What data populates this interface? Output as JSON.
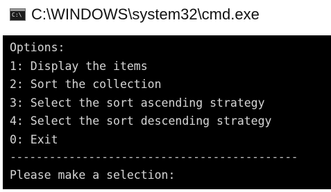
{
  "window": {
    "title": "C:\\WINDOWS\\system32\\cmd.exe",
    "icon": "cmd-console-icon",
    "icon_text": "C:\\"
  },
  "console": {
    "header": "Options:",
    "options": [
      "1: Display the items",
      "2: Sort the collection",
      "3: Select the sort ascending strategy",
      "4: Select the sort descending strategy",
      "0: Exit"
    ],
    "separator": "--------------------------------------------",
    "prompt": "Please make a selection:",
    "background_color": "#000000",
    "text_color": "#d6d6d6"
  }
}
